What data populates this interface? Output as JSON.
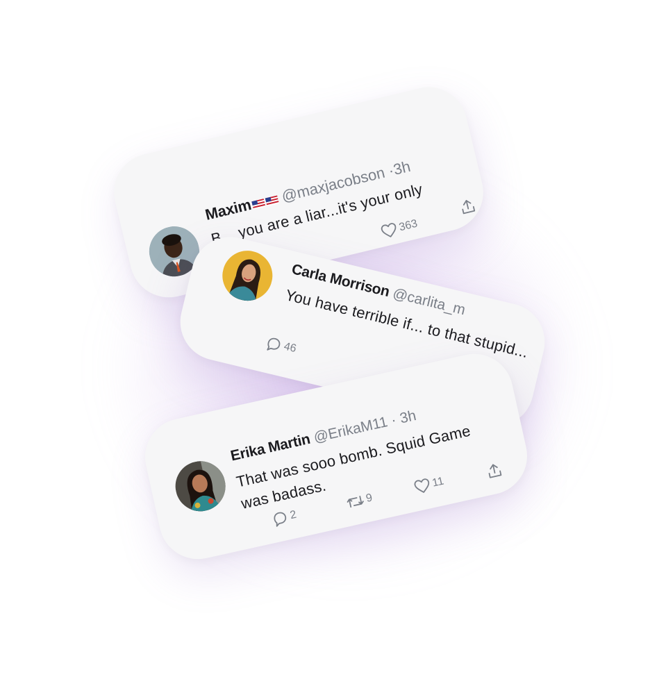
{
  "tweets": [
    {
      "name": "Maxim",
      "flags": "US flags",
      "handle": "@maxjacobson",
      "sep": " ·",
      "time": "3h",
      "text": "B... you are a liar...it's your only ...nning",
      "likes": "363"
    },
    {
      "name": "Carla Morrison",
      "handle": "@carlita_m",
      "text": "You have terrible if... to that stupid...",
      "replies": "46"
    },
    {
      "name": "Erika Martin",
      "handle": "@ErikaM11",
      "sep": " · ",
      "time": "3h",
      "text": "That was sooo bomb. Squid Game was badass.",
      "replies": "2",
      "retweets": "9",
      "likes": "11"
    }
  ],
  "colors": {
    "card": "#f6f6f7",
    "muted": "#7a7f88",
    "text": "#1b1b1f",
    "glow": "#c8a8e8"
  },
  "icons": [
    "reply-icon",
    "retweet-icon",
    "like-icon",
    "share-icon"
  ]
}
